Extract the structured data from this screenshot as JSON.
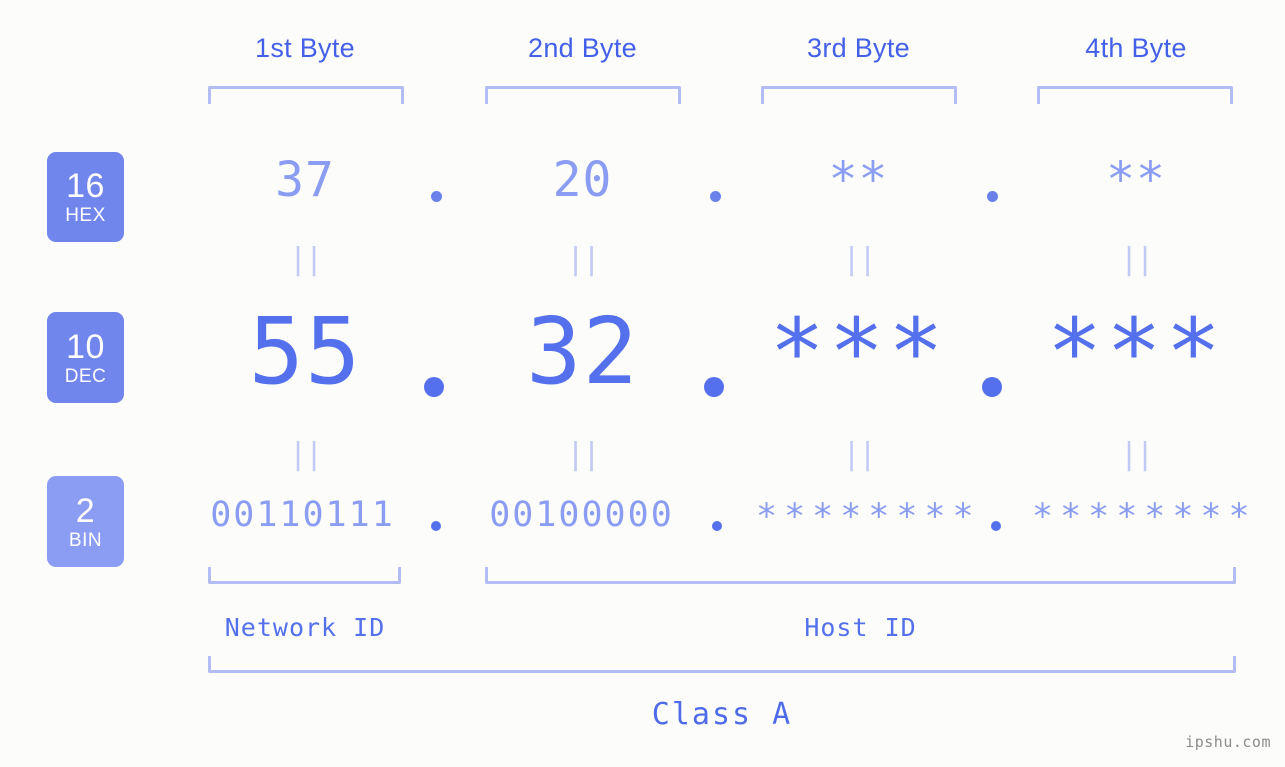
{
  "background_color": "#fcfdfa",
  "accent_color": "#5570ec",
  "accent_light_color": "#8b9df2",
  "bracket_color": "#b4bdf3",
  "badge_color": "#7186ed",
  "byte_headers": [
    {
      "label": "1st Byte"
    },
    {
      "label": "2nd Byte"
    },
    {
      "label": "3rd Byte"
    },
    {
      "label": "4th Byte"
    }
  ],
  "bases": [
    {
      "number": "16",
      "name": "HEX"
    },
    {
      "number": "10",
      "name": "DEC"
    },
    {
      "number": "2",
      "name": "BIN"
    }
  ],
  "rows": {
    "hex": {
      "base_number": "16",
      "base_name": "HEX",
      "bytes": [
        "37",
        "20",
        "**",
        "**"
      ],
      "separator": "."
    },
    "dec": {
      "base_number": "10",
      "base_name": "DEC",
      "bytes": [
        "55",
        "32",
        "***",
        "***"
      ],
      "separator": "."
    },
    "bin": {
      "base_number": "2",
      "base_name": "BIN",
      "bytes": [
        "00110111",
        "00100000",
        "********",
        "********"
      ],
      "separator": "."
    }
  },
  "equality_marks": {
    "symbol": "||",
    "between_hex_and_dec": [
      "||",
      "||",
      "||",
      "||"
    ],
    "between_dec_and_bin": [
      "||",
      "||",
      "||",
      "||"
    ]
  },
  "id_sections": [
    {
      "label": "Network ID"
    },
    {
      "label": "Host ID"
    }
  ],
  "class_label": "Class A",
  "watermark": "ipshu.com"
}
